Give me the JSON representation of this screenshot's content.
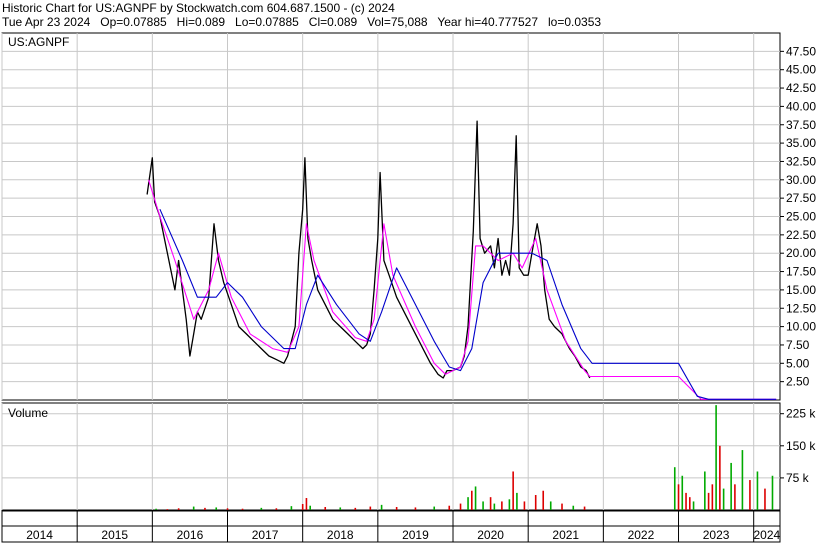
{
  "header": {
    "line1": "Historic Chart for US:AGNPF by Stockwatch.com 604.687.1500 - (c) 2024",
    "line2": "Tue Apr 23 2024   Op=0.07885   Hi=0.089   Lo=0.07885   Cl=0.089   Vol=75,088   Year hi=40.777527   lo=0.0353"
  },
  "colors": {
    "price": "#000000",
    "ma_short": "#ff00ff",
    "ma_long": "#0000cc",
    "vol_up": "#00aa00",
    "vol_down": "#dd0000",
    "grid": "#c8c8c8"
  },
  "chart_data": {
    "type": "line",
    "price_panel": {
      "label": "US:AGNPF",
      "ylim": [
        0,
        50
      ],
      "y_ticks": [
        "2.50",
        "5.00",
        "7.50",
        "10.00",
        "12.50",
        "15.00",
        "17.50",
        "20.00",
        "22.50",
        "25.00",
        "27.50",
        "30.00",
        "32.50",
        "35.00",
        "37.50",
        "40.00",
        "42.50",
        "45.00",
        "47.50"
      ],
      "grid": true,
      "series": [
        {
          "key": "price",
          "points": [
            [
              2015.93,
              28
            ],
            [
              2016.0,
              33
            ],
            [
              2016.03,
              27
            ],
            [
              2016.1,
              25
            ],
            [
              2016.2,
              20
            ],
            [
              2016.3,
              15
            ],
            [
              2016.35,
              19
            ],
            [
              2016.45,
              11
            ],
            [
              2016.5,
              6
            ],
            [
              2016.55,
              9
            ],
            [
              2016.6,
              12
            ],
            [
              2016.65,
              11
            ],
            [
              2016.75,
              14
            ],
            [
              2016.82,
              24
            ],
            [
              2016.88,
              19
            ],
            [
              2016.95,
              16
            ],
            [
              2017.05,
              13
            ],
            [
              2017.15,
              10
            ],
            [
              2017.25,
              9
            ],
            [
              2017.35,
              8
            ],
            [
              2017.45,
              7
            ],
            [
              2017.55,
              6
            ],
            [
              2017.65,
              5.5
            ],
            [
              2017.75,
              5
            ],
            [
              2017.8,
              6
            ],
            [
              2017.9,
              10
            ],
            [
              2017.95,
              20
            ],
            [
              2018.0,
              26
            ],
            [
              2018.03,
              33
            ],
            [
              2018.07,
              22
            ],
            [
              2018.12,
              19
            ],
            [
              2018.2,
              15
            ],
            [
              2018.3,
              13
            ],
            [
              2018.4,
              11
            ],
            [
              2018.5,
              10
            ],
            [
              2018.6,
              9
            ],
            [
              2018.7,
              8
            ],
            [
              2018.8,
              7
            ],
            [
              2018.85,
              7.5
            ],
            [
              2018.9,
              9
            ],
            [
              2018.95,
              15
            ],
            [
              2019.0,
              22
            ],
            [
              2019.03,
              31
            ],
            [
              2019.08,
              19
            ],
            [
              2019.15,
              17
            ],
            [
              2019.25,
              14
            ],
            [
              2019.4,
              11
            ],
            [
              2019.5,
              9
            ],
            [
              2019.6,
              7
            ],
            [
              2019.7,
              5
            ],
            [
              2019.8,
              3.5
            ],
            [
              2019.87,
              3
            ],
            [
              2019.92,
              4
            ],
            [
              2020.0,
              4
            ],
            [
              2020.1,
              4.5
            ],
            [
              2020.15,
              6
            ],
            [
              2020.2,
              10
            ],
            [
              2020.27,
              23
            ],
            [
              2020.32,
              38
            ],
            [
              2020.36,
              22
            ],
            [
              2020.42,
              20
            ],
            [
              2020.5,
              21
            ],
            [
              2020.55,
              18
            ],
            [
              2020.6,
              22
            ],
            [
              2020.65,
              17
            ],
            [
              2020.7,
              19
            ],
            [
              2020.75,
              17
            ],
            [
              2020.8,
              24
            ],
            [
              2020.84,
              36
            ],
            [
              2020.88,
              18
            ],
            [
              2020.94,
              17
            ],
            [
              2021.0,
              17
            ],
            [
              2021.05,
              20
            ],
            [
              2021.12,
              24
            ],
            [
              2021.17,
              21
            ],
            [
              2021.22,
              15
            ],
            [
              2021.28,
              11
            ],
            [
              2021.35,
              10
            ],
            [
              2021.45,
              9
            ],
            [
              2021.55,
              7
            ],
            [
              2021.62,
              6
            ],
            [
              2021.7,
              4.5
            ],
            [
              2021.77,
              4
            ],
            [
              2021.82,
              3
            ]
          ]
        },
        {
          "key": "ma_short",
          "points": [
            [
              2015.95,
              30
            ],
            [
              2016.1,
              25
            ],
            [
              2016.3,
              19
            ],
            [
              2016.55,
              11
            ],
            [
              2016.75,
              15
            ],
            [
              2016.88,
              20
            ],
            [
              2017.05,
              14
            ],
            [
              2017.3,
              9
            ],
            [
              2017.6,
              7
            ],
            [
              2017.8,
              6.5
            ],
            [
              2017.95,
              10
            ],
            [
              2018.05,
              24
            ],
            [
              2018.15,
              19
            ],
            [
              2018.4,
              12
            ],
            [
              2018.7,
              8.5
            ],
            [
              2018.85,
              8
            ],
            [
              2018.95,
              11
            ],
            [
              2019.08,
              24
            ],
            [
              2019.2,
              17
            ],
            [
              2019.5,
              10
            ],
            [
              2019.75,
              5
            ],
            [
              2019.9,
              3.5
            ],
            [
              2020.1,
              4.5
            ],
            [
              2020.2,
              8
            ],
            [
              2020.3,
              21
            ],
            [
              2020.4,
              21
            ],
            [
              2020.6,
              19
            ],
            [
              2020.8,
              20
            ],
            [
              2020.92,
              18
            ],
            [
              2021.1,
              22
            ],
            [
              2021.25,
              15
            ],
            [
              2021.5,
              8
            ],
            [
              2021.75,
              4
            ],
            [
              2021.82,
              3.2
            ],
            [
              2023.0,
              3.2
            ],
            [
              2023.3,
              0.1
            ],
            [
              2024.3,
              0.1
            ]
          ]
        },
        {
          "key": "ma_long",
          "points": [
            [
              2016.1,
              26
            ],
            [
              2016.4,
              19
            ],
            [
              2016.6,
              14
            ],
            [
              2016.85,
              14
            ],
            [
              2017.0,
              16
            ],
            [
              2017.2,
              14
            ],
            [
              2017.45,
              10
            ],
            [
              2017.75,
              7
            ],
            [
              2017.9,
              7
            ],
            [
              2018.05,
              13
            ],
            [
              2018.2,
              17
            ],
            [
              2018.45,
              13
            ],
            [
              2018.75,
              9
            ],
            [
              2018.9,
              8
            ],
            [
              2019.05,
              12
            ],
            [
              2019.25,
              18
            ],
            [
              2019.45,
              14
            ],
            [
              2019.75,
              8
            ],
            [
              2019.95,
              4.5
            ],
            [
              2020.1,
              4
            ],
            [
              2020.25,
              7
            ],
            [
              2020.4,
              16
            ],
            [
              2020.6,
              20
            ],
            [
              2020.85,
              20
            ],
            [
              2021.05,
              20
            ],
            [
              2021.25,
              19
            ],
            [
              2021.45,
              13
            ],
            [
              2021.7,
              7
            ],
            [
              2021.85,
              5
            ],
            [
              2023.0,
              5
            ],
            [
              2023.25,
              0.5
            ],
            [
              2023.4,
              0.1
            ],
            [
              2024.3,
              0.1
            ]
          ]
        }
      ]
    },
    "volume_panel": {
      "label": "Volume",
      "ylim": [
        0,
        250000
      ],
      "y_ticks": [
        "75 k",
        "150 k",
        "225 k"
      ],
      "grid": true,
      "bars": [
        [
          2016.05,
          3000,
          "up"
        ],
        [
          2016.2,
          2000,
          "down"
        ],
        [
          2016.35,
          4000,
          "down"
        ],
        [
          2016.55,
          8000,
          "up"
        ],
        [
          2016.7,
          5000,
          "down"
        ],
        [
          2016.85,
          6000,
          "up"
        ],
        [
          2017.0,
          4000,
          "down"
        ],
        [
          2017.2,
          3000,
          "down"
        ],
        [
          2017.45,
          5000,
          "up"
        ],
        [
          2017.65,
          4000,
          "down"
        ],
        [
          2017.85,
          9000,
          "up"
        ],
        [
          2018.0,
          14000,
          "down"
        ],
        [
          2018.05,
          28000,
          "down"
        ],
        [
          2018.1,
          10000,
          "up"
        ],
        [
          2018.3,
          7000,
          "down"
        ],
        [
          2018.5,
          6000,
          "up"
        ],
        [
          2018.7,
          5000,
          "down"
        ],
        [
          2018.9,
          8000,
          "down"
        ],
        [
          2019.05,
          12000,
          "up"
        ],
        [
          2019.25,
          7000,
          "down"
        ],
        [
          2019.5,
          6000,
          "down"
        ],
        [
          2019.75,
          8000,
          "up"
        ],
        [
          2019.95,
          10000,
          "down"
        ],
        [
          2020.1,
          15000,
          "down"
        ],
        [
          2020.2,
          30000,
          "up"
        ],
        [
          2020.25,
          45000,
          "down"
        ],
        [
          2020.3,
          55000,
          "up"
        ],
        [
          2020.4,
          20000,
          "up"
        ],
        [
          2020.5,
          30000,
          "down"
        ],
        [
          2020.55,
          15000,
          "up"
        ],
        [
          2020.65,
          20000,
          "down"
        ],
        [
          2020.75,
          25000,
          "up"
        ],
        [
          2020.8,
          90000,
          "down"
        ],
        [
          2020.85,
          40000,
          "up"
        ],
        [
          2020.95,
          20000,
          "down"
        ],
        [
          2021.1,
          35000,
          "down"
        ],
        [
          2021.2,
          45000,
          "down"
        ],
        [
          2021.3,
          20000,
          "up"
        ],
        [
          2021.45,
          15000,
          "down"
        ],
        [
          2021.6,
          10000,
          "up"
        ],
        [
          2021.75,
          8000,
          "down"
        ],
        [
          2022.95,
          100000,
          "up"
        ],
        [
          2023.0,
          60000,
          "down"
        ],
        [
          2023.05,
          80000,
          "up"
        ],
        [
          2023.1,
          40000,
          "down"
        ],
        [
          2023.15,
          30000,
          "down"
        ],
        [
          2023.2,
          20000,
          "up"
        ],
        [
          2023.35,
          90000,
          "up"
        ],
        [
          2023.4,
          40000,
          "down"
        ],
        [
          2023.45,
          60000,
          "down"
        ],
        [
          2023.5,
          245000,
          "up"
        ],
        [
          2023.55,
          150000,
          "down"
        ],
        [
          2023.6,
          50000,
          "up"
        ],
        [
          2023.7,
          110000,
          "up"
        ],
        [
          2023.75,
          60000,
          "down"
        ],
        [
          2023.85,
          140000,
          "up"
        ],
        [
          2023.95,
          70000,
          "down"
        ],
        [
          2024.05,
          90000,
          "up"
        ],
        [
          2024.15,
          50000,
          "down"
        ],
        [
          2024.25,
          80000,
          "up"
        ]
      ]
    },
    "x_axis": {
      "xlim": [
        2014,
        2024.35
      ],
      "tick_labels": [
        "2014",
        "2015",
        "2016",
        "2017",
        "2018",
        "2019",
        "2020",
        "2021",
        "2022",
        "2023",
        "2024"
      ]
    }
  }
}
